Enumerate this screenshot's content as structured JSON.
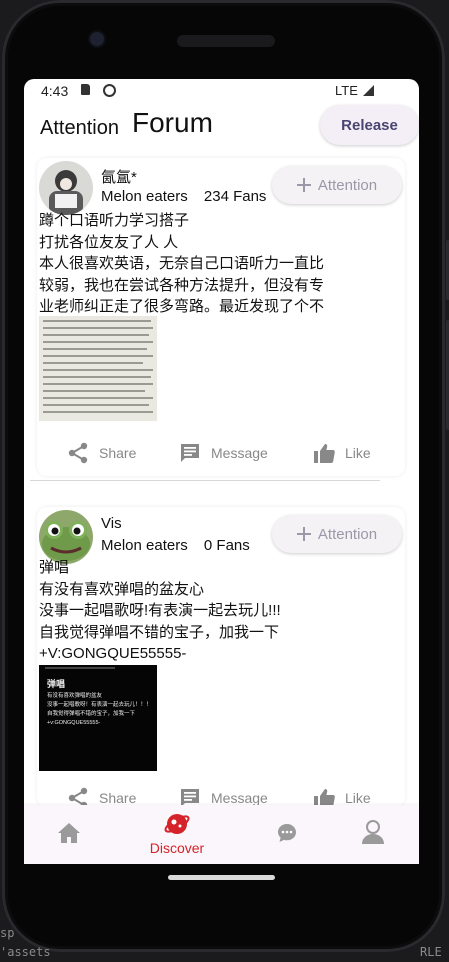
{
  "status_bar": {
    "time": "4:43",
    "network": "LTE"
  },
  "header": {
    "tab_attention": "Attention",
    "tab_forum": "Forum",
    "release_label": "Release"
  },
  "posts": [
    {
      "username": "氤氲*",
      "group": "Melon eaters",
      "fans": "234 Fans",
      "attention_label": "Attention",
      "lines": [
        "蹲个口语听力学习搭子",
        "打扰各位友友了人 人",
        "本人很喜欢英语，无奈自己口语听力一直比",
        "较弱，我也在尝试各种方法提升，但没有专",
        "业老师纠正走了很多弯路。最近发现了个不"
      ],
      "actions": {
        "share": "Share",
        "message": "Message",
        "like": "Like"
      }
    },
    {
      "username": "Vis",
      "group": "Melon eaters",
      "fans": "0 Fans",
      "attention_label": "Attention",
      "lines": [
        "弹唱",
        "有没有喜欢弹唱的盆友心",
        "没事一起唱歌呀!有表演一起去玩儿!!!",
        "自我觉得弹唱不错的宝子，加我一下",
        "+V:GONGQUE55555-"
      ],
      "image_title": "弹唱",
      "image_lines": [
        "有没有喜欢弹唱的盆友",
        "没事一起唱歌呀！有表演一起去玩儿！！！",
        "自我觉得弹唱不错的宝子，加我一下",
        "+v:GONGQUE55555-"
      ],
      "actions": {
        "share": "Share",
        "message": "Message",
        "like": "Like"
      }
    }
  ],
  "bottom_nav": [
    {
      "icon": "home-icon",
      "label": ""
    },
    {
      "icon": "planet-icon",
      "label": "Discover",
      "active": true
    },
    {
      "icon": "chat-icon",
      "label": ""
    },
    {
      "icon": "person-icon",
      "label": ""
    }
  ],
  "colors": {
    "accent": "#d4232a",
    "nav_bg": "#fbf6fb",
    "button_bg": "#f5f2f6"
  },
  "background_text": {
    "left": "sp",
    "bottom": "'assets",
    "right": "RLE"
  }
}
